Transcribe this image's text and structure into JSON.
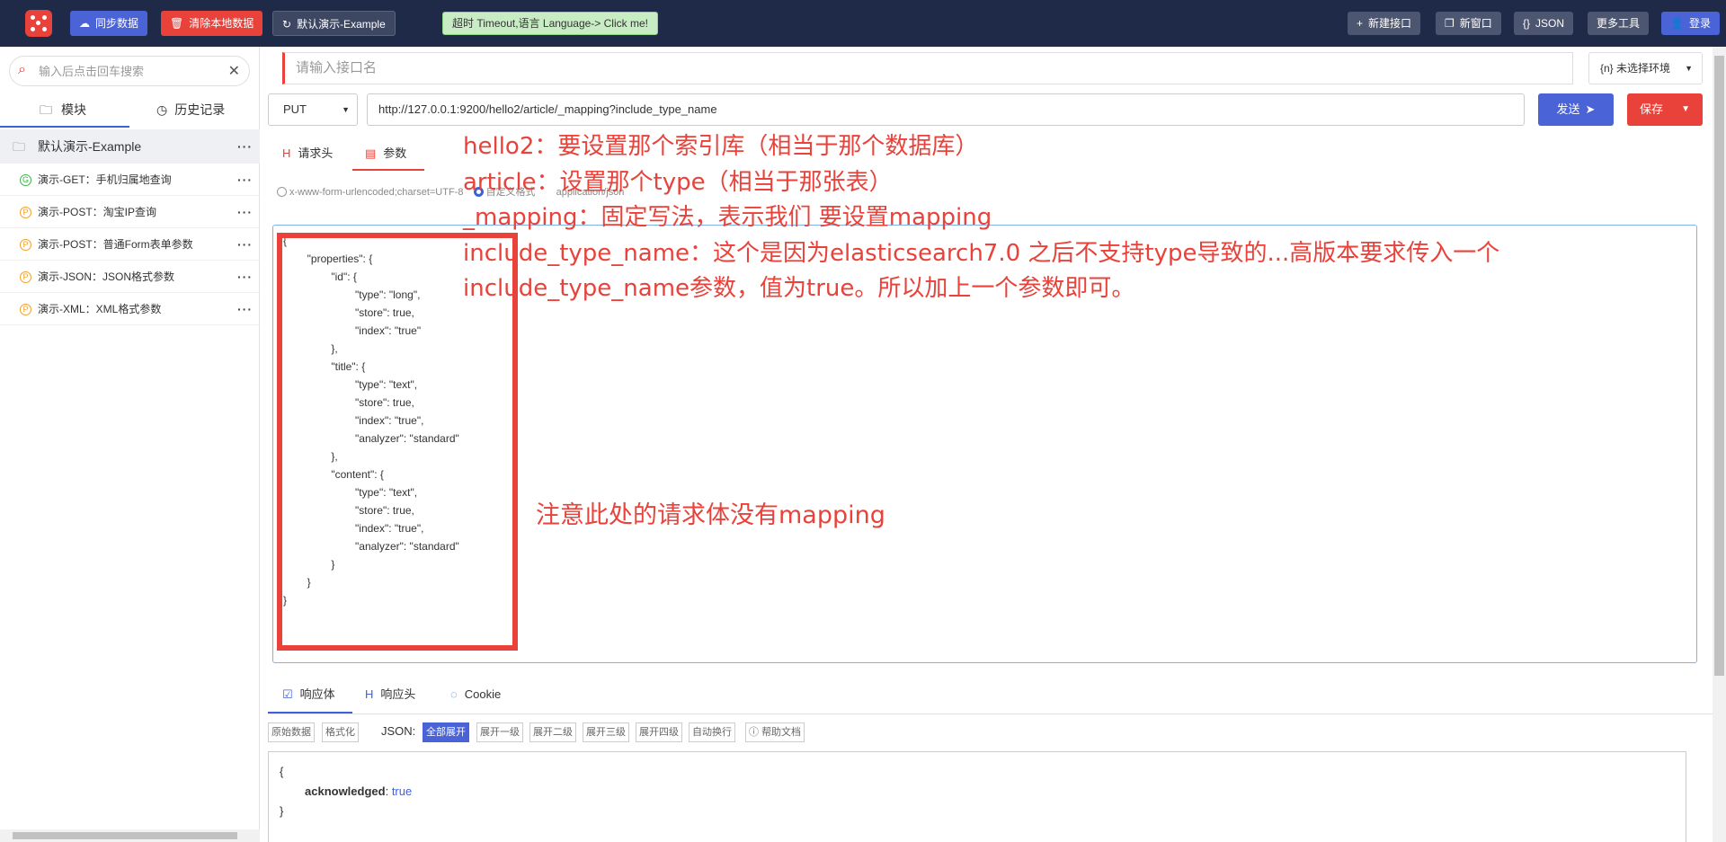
{
  "topbar": {
    "sync_label": "同步数据",
    "clear_label": "清除本地数据",
    "demo_label": "默认演示-Example",
    "lang_label": "超时 Timeout,语言 Language-> Click me!",
    "new_api_label": "新建接口",
    "new_window_label": "新窗口",
    "json_label": "JSON",
    "more_tools_label": "更多工具",
    "login_label": "登录"
  },
  "sidebar": {
    "search_placeholder": "输入后点击回车搜索",
    "tabs": [
      {
        "label": "模块"
      },
      {
        "label": "历史记录"
      }
    ],
    "group_title": "默认演示-Example",
    "items": [
      {
        "method": "G",
        "color": "#3db34a",
        "label": "演示-GET：手机归属地查询"
      },
      {
        "method": "P",
        "color": "#f0a030",
        "label": "演示-POST：淘宝IP查询"
      },
      {
        "method": "P",
        "color": "#f0a030",
        "label": "演示-POST：普通Form表单参数"
      },
      {
        "method": "P",
        "color": "#f0a030",
        "label": "演示-JSON：JSON格式参数"
      },
      {
        "method": "P",
        "color": "#f0a030",
        "label": "演示-XML：XML格式参数"
      }
    ]
  },
  "request": {
    "name_placeholder": "请输入接口名",
    "env_label": "{n} 未选择环境",
    "method": "PUT",
    "url": "http://127.0.0.1:9200/hello2/article/_mapping?include_type_name",
    "send_label": "发送",
    "save_label": "保存",
    "tabs": [
      {
        "label": "请求头"
      },
      {
        "label": "参数"
      }
    ],
    "radio_form": "x-www-form-urlencoded;charset=UTF-8",
    "radio_custom": "自定义格式",
    "radio_json": "application/json",
    "body": "{\n        \"properties\": {\n                \"id\": {\n                        \"type\": \"long\",\n                        \"store\": true,\n                        \"index\": \"true\"\n                },\n                \"title\": {\n                        \"type\": \"text\",\n                        \"store\": true,\n                        \"index\": \"true\",\n                        \"analyzer\": \"standard\"\n                },\n                \"content\": {\n                        \"type\": \"text\",\n                        \"store\": true,\n                        \"index\": \"true\",\n                        \"analyzer\": \"standard\"\n                }\n        }\n}"
  },
  "annotations": {
    "lines": [
      "hello2：要设置那个索引库（相当于那个数据库）",
      "article：设置那个type（相当于那张表）",
      "_mapping：固定写法，表示我们 要设置mapping",
      "include_type_name：这个是因为elasticsearch7.0 之后不支持type导致的...高版本要求传入一个",
      "include_type_name参数，值为true。所以加上一个参数即可。"
    ],
    "note": "注意此处的请求体没有mapping"
  },
  "response": {
    "tabs": [
      {
        "label": "响应体"
      },
      {
        "label": "响应头"
      },
      {
        "label": "Cookie"
      }
    ],
    "raw_label": "原始数据",
    "format_label": "格式化",
    "json_label": "JSON:",
    "expand_buttons": [
      "全部展开",
      "展开一级",
      "展开二级",
      "展开三级",
      "展开四级",
      "自动换行"
    ],
    "help_label": "帮助文档",
    "open_brace": "{",
    "key": "acknowledged",
    "value": "true",
    "close_brace": "}"
  },
  "colors": {
    "topbar": "#1f2a48",
    "accent_blue": "#4a63d6",
    "accent_red": "#e8423a",
    "annotation": "#e8423a"
  },
  "icons": [
    "dice-logo-icon",
    "cloud-sync-icon",
    "trash-icon",
    "refresh-icon",
    "plus-icon",
    "window-icon",
    "json-icon",
    "user-icon",
    "search-icon",
    "clear-icon",
    "folder-icon",
    "clock-icon",
    "send-icon",
    "caret-down-icon",
    "header-icon",
    "params-icon",
    "checkbox-icon",
    "cookie-icon",
    "help-icon"
  ]
}
